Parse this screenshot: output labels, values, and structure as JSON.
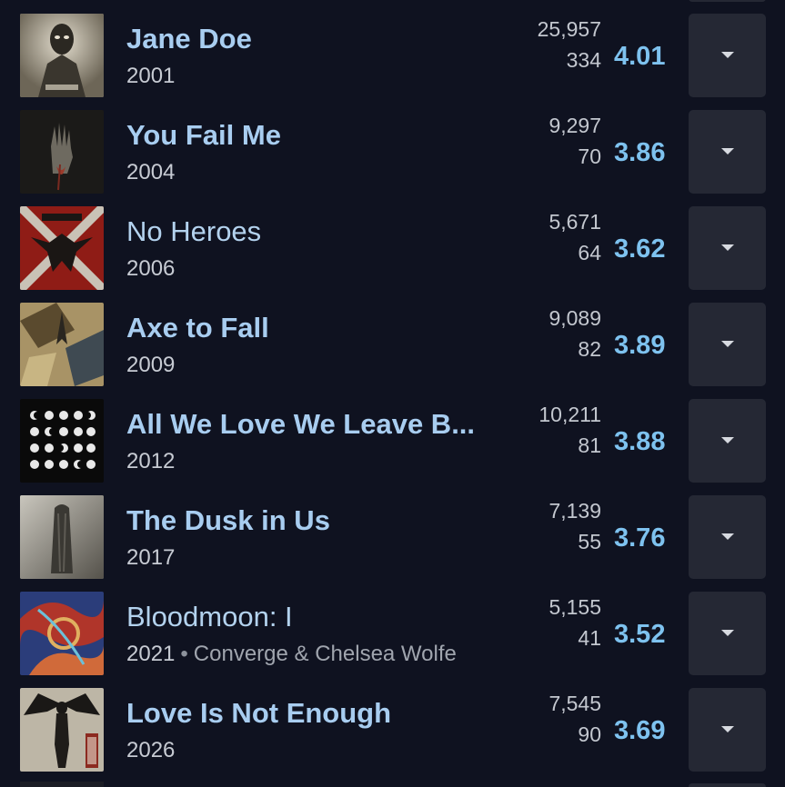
{
  "colors": {
    "background": "#0f1220",
    "title": "#a8cdf0",
    "rating": "#7ec2ef",
    "button": "#252834"
  },
  "albums": [
    {
      "title": "Jane Doe",
      "year": "2001",
      "artists": "",
      "ratings": "25,957",
      "reviews": "334",
      "avg": "4.01",
      "bold": true,
      "cover": "jane-doe-cover"
    },
    {
      "title": "You Fail Me",
      "year": "2004",
      "artists": "",
      "ratings": "9,297",
      "reviews": "70",
      "avg": "3.86",
      "bold": true,
      "cover": "you-fail-me-cover"
    },
    {
      "title": "No Heroes",
      "year": "2006",
      "artists": "",
      "ratings": "5,671",
      "reviews": "64",
      "avg": "3.62",
      "bold": false,
      "cover": "no-heroes-cover"
    },
    {
      "title": "Axe to Fall",
      "year": "2009",
      "artists": "",
      "ratings": "9,089",
      "reviews": "82",
      "avg": "3.89",
      "bold": true,
      "cover": "axe-to-fall-cover"
    },
    {
      "title": "All We Love We Leave B...",
      "year": "2012",
      "artists": "",
      "ratings": "10,211",
      "reviews": "81",
      "avg": "3.88",
      "bold": true,
      "cover": "all-we-love-cover"
    },
    {
      "title": "The Dusk in Us",
      "year": "2017",
      "artists": "",
      "ratings": "7,139",
      "reviews": "55",
      "avg": "3.76",
      "bold": true,
      "cover": "dusk-in-us-cover"
    },
    {
      "title": "Bloodmoon: I",
      "year": "2021",
      "artists": "Converge & Chelsea Wolfe",
      "ratings": "5,155",
      "reviews": "41",
      "avg": "3.52",
      "bold": false,
      "cover": "bloodmoon-cover"
    },
    {
      "title": "Love Is Not Enough",
      "year": "2026",
      "artists": "",
      "ratings": "7,545",
      "reviews": "90",
      "avg": "3.69",
      "bold": true,
      "cover": "love-is-not-enough-cover"
    }
  ],
  "menu_icon": "chevron-down-icon",
  "separator": "•"
}
